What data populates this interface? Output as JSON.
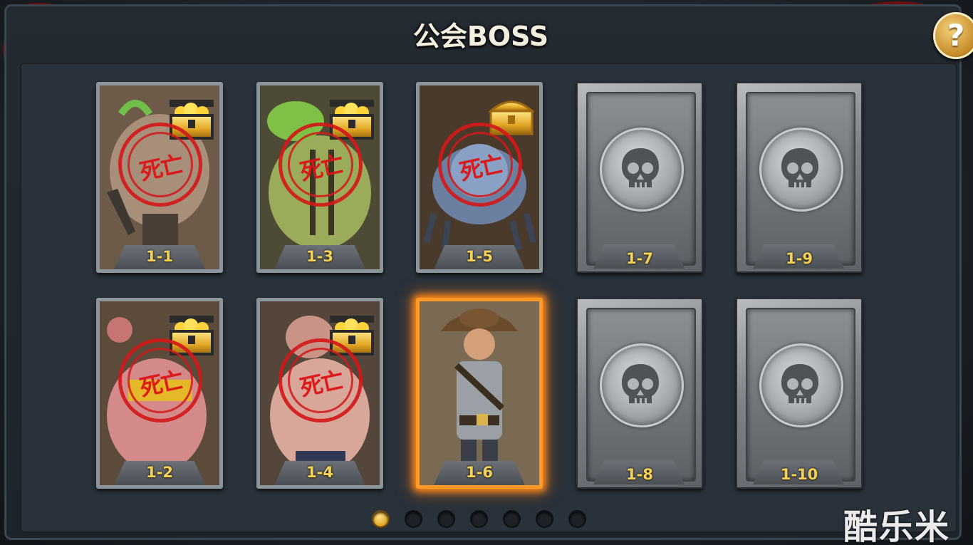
{
  "window": {
    "title": "公会BOSS",
    "help_label": "?"
  },
  "colors": {
    "accent": "#f5d35a",
    "stamp": "#d21919",
    "highlight": "#ff9a25"
  },
  "stamp_text": "死亡",
  "cards": [
    {
      "label": "1-1",
      "state": "defeated",
      "reward": "gold-chest-open",
      "art": "green-tentacle-brute"
    },
    {
      "label": "1-3",
      "state": "defeated",
      "reward": "gold-chest-open",
      "art": "green-bloated-zombie"
    },
    {
      "label": "1-5",
      "state": "defeated",
      "reward": "gold-chest-closed",
      "art": "blue-crawler"
    },
    {
      "label": "1-7",
      "state": "locked",
      "art": "skull-icon"
    },
    {
      "label": "1-9",
      "state": "locked",
      "art": "skull-icon"
    },
    {
      "label": "1-2",
      "state": "defeated",
      "reward": "gold-chest-open",
      "art": "pink-fat-zombie"
    },
    {
      "label": "1-4",
      "state": "defeated",
      "reward": "gold-chest-open",
      "art": "pale-fat-zombie"
    },
    {
      "label": "1-6",
      "state": "current",
      "art": "sheriff"
    },
    {
      "label": "1-8",
      "state": "locked",
      "art": "skull-icon"
    },
    {
      "label": "1-10",
      "state": "locked",
      "art": "skull-icon"
    }
  ],
  "pagination": {
    "total": 7,
    "current": 1
  },
  "watermark": "酷乐米"
}
